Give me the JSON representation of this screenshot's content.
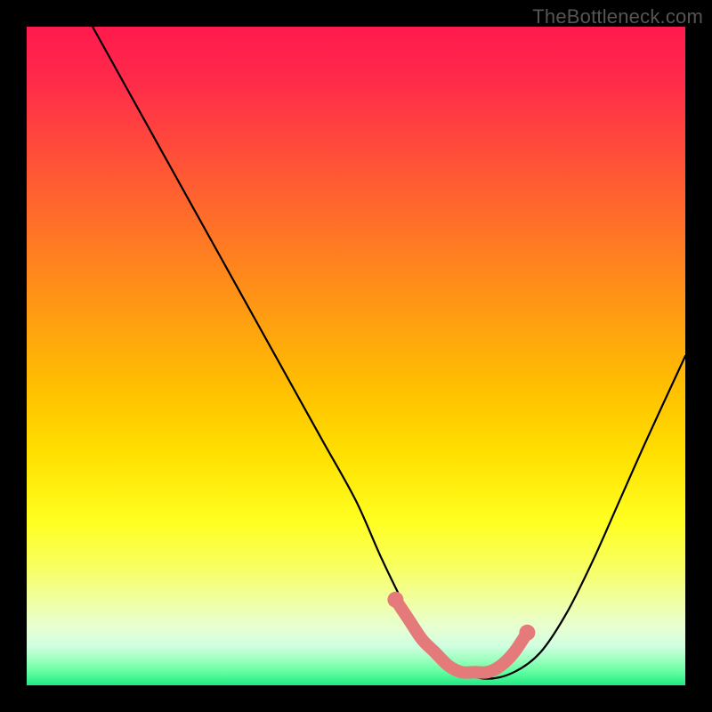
{
  "watermark": "TheBottleneck.com",
  "chart_data": {
    "type": "line",
    "title": "",
    "xlabel": "",
    "ylabel": "",
    "xlim": [
      0,
      100
    ],
    "ylim": [
      0,
      100
    ],
    "series": [
      {
        "name": "bottleneck-curve",
        "x": [
          10,
          15,
          20,
          25,
          30,
          35,
          40,
          45,
          50,
          54,
          58,
          62,
          66,
          70,
          74,
          78,
          82,
          86,
          90,
          94,
          100
        ],
        "y": [
          100,
          91,
          82,
          73,
          64,
          55,
          46,
          37,
          28,
          19,
          11,
          5,
          2,
          1,
          2,
          5,
          11,
          19,
          28,
          37,
          50
        ]
      },
      {
        "name": "highlight-segment",
        "x": [
          56,
          58,
          60,
          62,
          64,
          66,
          68,
          70,
          72,
          74,
          76
        ],
        "y": [
          13,
          10,
          7,
          5,
          3,
          2,
          2,
          2,
          3,
          5,
          8
        ]
      }
    ],
    "colors": {
      "curve": "#000000",
      "highlight": "#e47a7a",
      "gradient_top": "#ff1a4d",
      "gradient_bottom": "#20e880"
    }
  }
}
